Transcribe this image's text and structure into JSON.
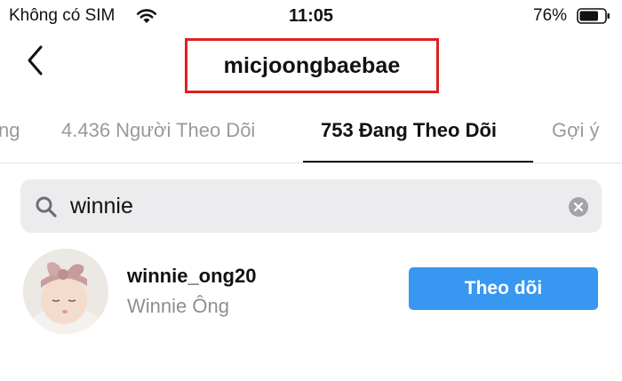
{
  "status_bar": {
    "carrier": "Không có SIM",
    "time": "11:05",
    "battery_percent": "76%",
    "battery_level": 0.76,
    "icons": [
      "wifi-icon",
      "battery-icon"
    ]
  },
  "header": {
    "title": "micjoongbaebae",
    "back_icon": "chevron-left-icon",
    "highlight_color": "#e02020"
  },
  "tabs": [
    {
      "label": "ng",
      "active": false
    },
    {
      "label": "4.436 Người Theo Dõi",
      "active": false
    },
    {
      "label": "753 Đang Theo Dõi",
      "active": true
    },
    {
      "label": "Gợi ý",
      "active": false
    }
  ],
  "search": {
    "value": "winnie",
    "icon": "search-icon",
    "clear_icon": "clear-icon"
  },
  "results": [
    {
      "username": "winnie_ong20",
      "full_name": "Winnie Ông",
      "button_label": "Theo dõi"
    }
  ],
  "colors": {
    "accent": "#3897f0",
    "muted_text": "#8e8e8e",
    "search_bg": "#ececee"
  }
}
